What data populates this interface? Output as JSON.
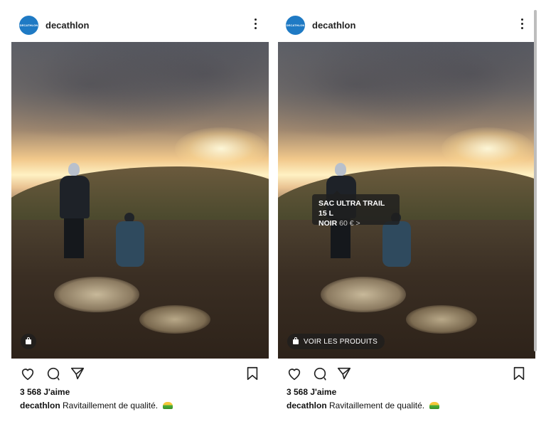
{
  "posts": [
    {
      "username": "decathlon",
      "avatar_text": "DECATHLON",
      "likes": "3 568 J'aime",
      "caption_user": "decathlon",
      "caption_text": "Ravitaillement de qualité."
    },
    {
      "username": "decathlon",
      "avatar_text": "DECATHLON",
      "likes": "3 568 J'aime",
      "caption_user": "decathlon",
      "caption_text": "Ravitaillement de qualité.",
      "shop_button": "VOIR LES PRODUITS",
      "product_tag": {
        "name_line1": "SAC ULTRA TRAIL 15 L",
        "name_line2": "NOIR",
        "price": "60 € >"
      }
    }
  ],
  "colors": {
    "brand": "#1f7ac4",
    "text": "#111111"
  },
  "icons": [
    "more-icon",
    "heart-icon",
    "comment-icon",
    "share-icon",
    "bookmark-icon",
    "shopping-bag-icon"
  ]
}
